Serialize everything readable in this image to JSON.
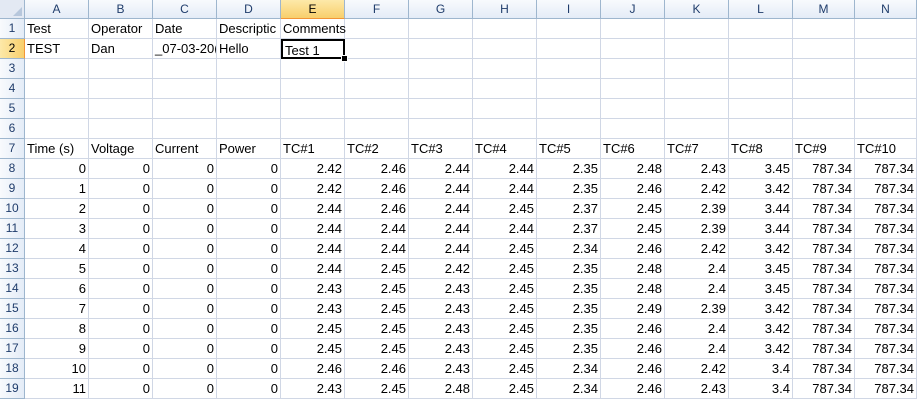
{
  "columns": [
    "A",
    "B",
    "C",
    "D",
    "E",
    "F",
    "G",
    "H",
    "I",
    "J",
    "K",
    "L",
    "M",
    "N"
  ],
  "rows": [
    "1",
    "2",
    "3",
    "4",
    "5",
    "6",
    "7",
    "8",
    "9",
    "10",
    "11",
    "12",
    "13",
    "14",
    "15",
    "16",
    "17",
    "18",
    "19"
  ],
  "selected": {
    "col": "E",
    "row": "2"
  },
  "cells": {
    "1": [
      "Test",
      "Operator",
      "Date",
      "Descriptic",
      "Comments",
      "",
      "",
      "",
      "",
      "",
      "",
      "",
      "",
      ""
    ],
    "2": [
      "TEST",
      "Dan",
      "_07-03-20(",
      "Hello",
      "Test 1",
      "",
      "",
      "",
      "",
      "",
      "",
      "",
      "",
      ""
    ],
    "3": [
      "",
      "",
      "",
      "",
      "",
      "",
      "",
      "",
      "",
      "",
      "",
      "",
      "",
      ""
    ],
    "4": [
      "",
      "",
      "",
      "",
      "",
      "",
      "",
      "",
      "",
      "",
      "",
      "",
      "",
      ""
    ],
    "5": [
      "",
      "",
      "",
      "",
      "",
      "",
      "",
      "",
      "",
      "",
      "",
      "",
      "",
      ""
    ],
    "6": [
      "",
      "",
      "",
      "",
      "",
      "",
      "",
      "",
      "",
      "",
      "",
      "",
      "",
      ""
    ],
    "7": [
      "Time (s)",
      "Voltage",
      "Current",
      "Power",
      "TC#1",
      "TC#2",
      "TC#3",
      "TC#4",
      "TC#5",
      "TC#6",
      "TC#7",
      "TC#8",
      "TC#9",
      "TC#10"
    ],
    "8": [
      "0",
      "0",
      "0",
      "0",
      "2.42",
      "2.46",
      "2.44",
      "2.44",
      "2.35",
      "2.48",
      "2.43",
      "3.45",
      "787.34",
      "787.34"
    ],
    "9": [
      "1",
      "0",
      "0",
      "0",
      "2.42",
      "2.46",
      "2.44",
      "2.44",
      "2.35",
      "2.46",
      "2.42",
      "3.42",
      "787.34",
      "787.34"
    ],
    "10": [
      "2",
      "0",
      "0",
      "0",
      "2.44",
      "2.46",
      "2.44",
      "2.45",
      "2.37",
      "2.45",
      "2.39",
      "3.44",
      "787.34",
      "787.34"
    ],
    "11": [
      "3",
      "0",
      "0",
      "0",
      "2.44",
      "2.44",
      "2.44",
      "2.44",
      "2.37",
      "2.45",
      "2.39",
      "3.44",
      "787.34",
      "787.34"
    ],
    "12": [
      "4",
      "0",
      "0",
      "0",
      "2.44",
      "2.44",
      "2.44",
      "2.45",
      "2.34",
      "2.46",
      "2.42",
      "3.42",
      "787.34",
      "787.34"
    ],
    "13": [
      "5",
      "0",
      "0",
      "0",
      "2.44",
      "2.45",
      "2.42",
      "2.45",
      "2.35",
      "2.48",
      "2.4",
      "3.45",
      "787.34",
      "787.34"
    ],
    "14": [
      "6",
      "0",
      "0",
      "0",
      "2.43",
      "2.45",
      "2.43",
      "2.45",
      "2.35",
      "2.48",
      "2.4",
      "3.45",
      "787.34",
      "787.34"
    ],
    "15": [
      "7",
      "0",
      "0",
      "0",
      "2.43",
      "2.45",
      "2.43",
      "2.45",
      "2.35",
      "2.49",
      "2.39",
      "3.42",
      "787.34",
      "787.34"
    ],
    "16": [
      "8",
      "0",
      "0",
      "0",
      "2.45",
      "2.45",
      "2.43",
      "2.45",
      "2.35",
      "2.46",
      "2.4",
      "3.42",
      "787.34",
      "787.34"
    ],
    "17": [
      "9",
      "0",
      "0",
      "0",
      "2.45",
      "2.45",
      "2.43",
      "2.45",
      "2.35",
      "2.46",
      "2.4",
      "3.42",
      "787.34",
      "787.34"
    ],
    "18": [
      "10",
      "0",
      "0",
      "0",
      "2.46",
      "2.46",
      "2.43",
      "2.45",
      "2.34",
      "2.46",
      "2.42",
      "3.4",
      "787.34",
      "787.34"
    ],
    "19": [
      "11",
      "0",
      "0",
      "0",
      "2.43",
      "2.45",
      "2.48",
      "2.45",
      "2.34",
      "2.46",
      "2.43",
      "3.4",
      "787.34",
      "787.34"
    ]
  },
  "colors": {
    "grid": "#d0d7e5",
    "header_border": "#9eb6ce",
    "selection_header": "#f8cf6c",
    "header_text": "#1f3c6b"
  }
}
